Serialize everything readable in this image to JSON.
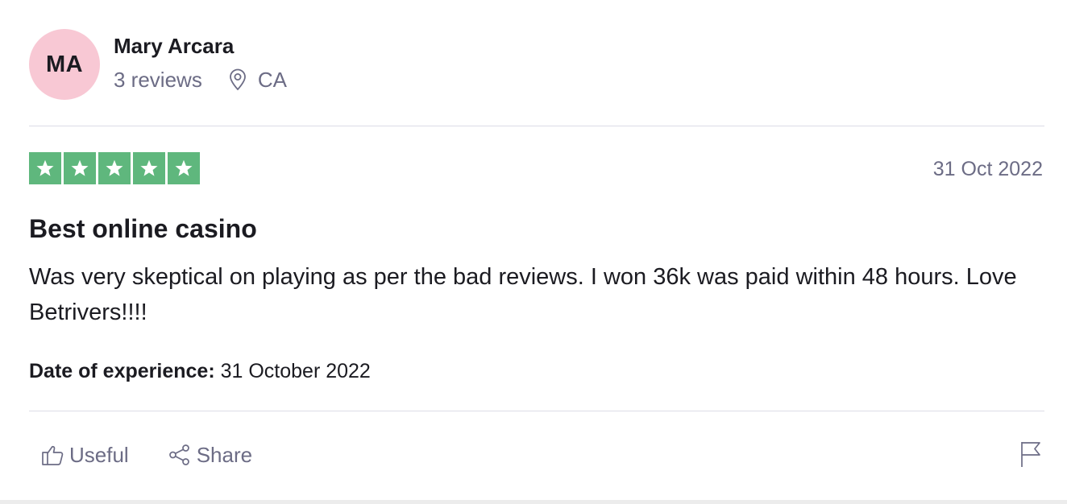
{
  "consumer": {
    "initials": "MA",
    "avatar_color": "#f8c8d4",
    "name": "Mary Arcara",
    "reviews_count": "3 reviews",
    "location_icon": "map-pin-icon",
    "location": "CA"
  },
  "review": {
    "rating": 5,
    "rating_max": 5,
    "star_color": "#5fb77d",
    "date": "31 Oct 2022",
    "title": "Best online casino",
    "text": "Was very skeptical on playing as per the bad reviews. I won 36k was paid within 48 hours. Love Betrivers!!!!",
    "experience_label": "Date of experience:",
    "experience_date": "31 October 2022"
  },
  "actions": {
    "useful_label": "Useful",
    "useful_icon": "thumbs-up-icon",
    "share_label": "Share",
    "share_icon": "share-icon",
    "flag_icon": "flag-icon"
  }
}
